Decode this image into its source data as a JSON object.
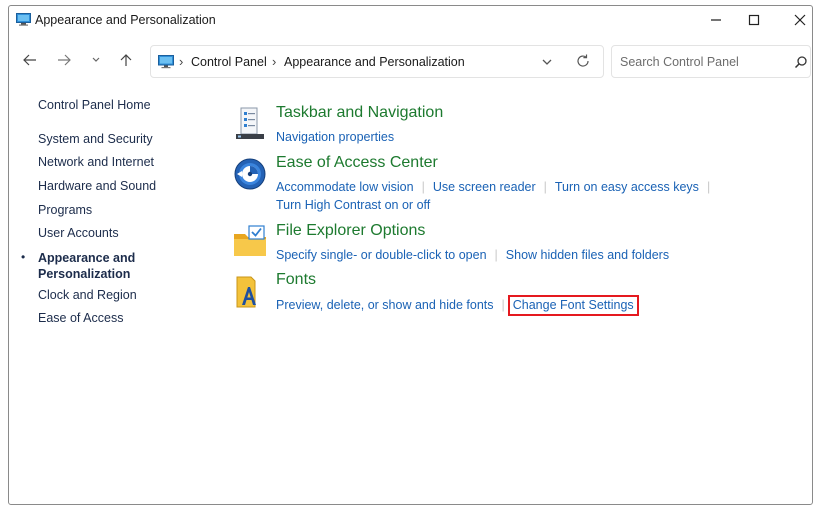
{
  "window": {
    "title": "Appearance and Personalization"
  },
  "nav": {
    "breadcrumb": [
      "Control Panel",
      "Appearance and Personalization"
    ],
    "search_placeholder": "Search Control Panel"
  },
  "sidebar": {
    "home": "Control Panel Home",
    "items": [
      "System and Security",
      "Network and Internet",
      "Hardware and Sound",
      "Programs",
      "User Accounts"
    ],
    "active_line1": "Appearance and",
    "active_line2": "Personalization",
    "items_after": [
      "Clock and Region",
      "Ease of Access"
    ]
  },
  "categories": {
    "taskbar": {
      "title": "Taskbar and Navigation",
      "links": [
        "Navigation properties"
      ]
    },
    "ease": {
      "title": "Ease of Access Center",
      "links": [
        "Accommodate low vision",
        "Use screen reader",
        "Turn on easy access keys",
        "Turn High Contrast on or off"
      ]
    },
    "explorer": {
      "title": "File Explorer Options",
      "links": [
        "Specify single- or double-click to open",
        "Show hidden files and folders"
      ]
    },
    "fonts": {
      "title": "Fonts",
      "links": [
        "Preview, delete, or show and hide fonts",
        "Change Font Settings"
      ]
    }
  },
  "colors": {
    "category_title": "#1d7a2f",
    "link": "#1a62b5",
    "highlight_box": "#e5191f"
  },
  "icons": [
    "monitor-icon",
    "minimize-icon",
    "maximize-icon",
    "close-icon",
    "back-arrow-icon",
    "forward-arrow-icon",
    "chevron-down-icon",
    "up-arrow-icon",
    "refresh-icon",
    "search-icon",
    "taskbar-icon",
    "ease-of-access-icon",
    "folder-icon",
    "fonts-icon"
  ]
}
